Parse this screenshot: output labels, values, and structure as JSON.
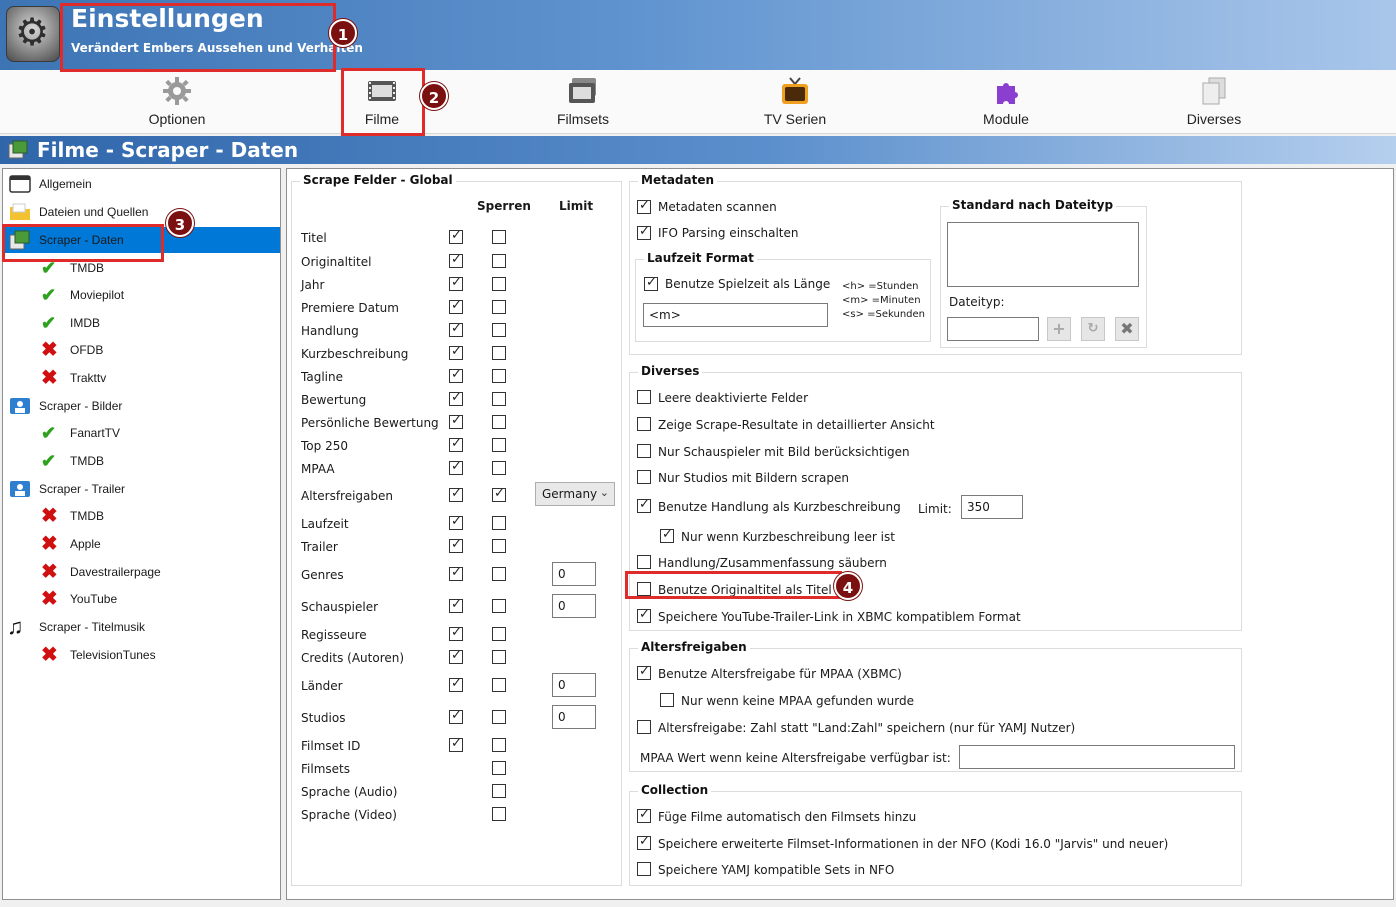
{
  "header": {
    "title": "Einstellungen",
    "subtitle": "Verändert Embers Aussehen und Verhalten"
  },
  "toolbar": {
    "items": [
      {
        "label": "Optionen",
        "icon": "gear-icon"
      },
      {
        "label": "Filme",
        "icon": "film-icon"
      },
      {
        "label": "Filmsets",
        "icon": "filmsets-icon"
      },
      {
        "label": "TV Serien",
        "icon": "tv-icon"
      },
      {
        "label": "Module",
        "icon": "puzzle-icon"
      },
      {
        "label": "Diverses",
        "icon": "documents-icon"
      }
    ]
  },
  "section": {
    "title": "Filme - Scraper - Daten"
  },
  "tree": {
    "items": [
      {
        "label": "Allgemein",
        "icon": "window-icon",
        "level": 0
      },
      {
        "label": "Dateien und Quellen",
        "icon": "folder-icon",
        "level": 0
      },
      {
        "label": "Scraper - Daten",
        "icon": "scraper-data-icon",
        "level": 0,
        "selected": true
      },
      {
        "label": "TMDB",
        "icon": "check-icon",
        "level": 1
      },
      {
        "label": "Moviepilot",
        "icon": "check-icon",
        "level": 1
      },
      {
        "label": "IMDB",
        "icon": "check-icon",
        "level": 1
      },
      {
        "label": "OFDB",
        "icon": "x-icon",
        "level": 1
      },
      {
        "label": "Trakttv",
        "icon": "x-icon",
        "level": 1
      },
      {
        "label": "Scraper - Bilder",
        "icon": "image-icon",
        "level": 0
      },
      {
        "label": "FanartTV",
        "icon": "check-icon",
        "level": 1
      },
      {
        "label": "TMDB",
        "icon": "check-icon",
        "level": 1
      },
      {
        "label": "Scraper - Trailer",
        "icon": "image-icon",
        "level": 0
      },
      {
        "label": "TMDB",
        "icon": "x-icon",
        "level": 1
      },
      {
        "label": "Apple",
        "icon": "x-icon",
        "level": 1
      },
      {
        "label": "Davestrailerpage",
        "icon": "x-icon",
        "level": 1
      },
      {
        "label": "YouTube",
        "icon": "x-icon",
        "level": 1
      },
      {
        "label": "Scraper - Titelmusik",
        "icon": "music-icon",
        "level": 0
      },
      {
        "label": "TelevisionTunes",
        "icon": "x-icon",
        "level": 1
      }
    ]
  },
  "scrape_fields": {
    "title": "Scrape Felder - Global",
    "col_lock": "Sperren",
    "col_limit": "Limit",
    "rows": [
      {
        "label": "Titel",
        "global": true,
        "lock": false
      },
      {
        "label": "Originaltitel",
        "global": true,
        "lock": false
      },
      {
        "label": "Jahr",
        "global": true,
        "lock": false
      },
      {
        "label": "Premiere Datum",
        "global": true,
        "lock": false
      },
      {
        "label": "Handlung",
        "global": true,
        "lock": false
      },
      {
        "label": "Kurzbeschreibung",
        "global": true,
        "lock": false
      },
      {
        "label": "Tagline",
        "global": true,
        "lock": false
      },
      {
        "label": "Bewertung",
        "global": true,
        "lock": false
      },
      {
        "label": "Persönliche Bewertung",
        "global": true,
        "lock": false
      },
      {
        "label": "Top 250",
        "global": true,
        "lock": false
      },
      {
        "label": "MPAA",
        "global": true,
        "lock": false
      },
      {
        "label": "Altersfreigaben",
        "global": true,
        "lock": true,
        "combo": "Germany"
      },
      {
        "label": "Laufzeit",
        "global": true,
        "lock": false
      },
      {
        "label": "Trailer",
        "global": true,
        "lock": false
      },
      {
        "label": "Genres",
        "global": true,
        "lock": false,
        "limit": "0"
      },
      {
        "label": "Schauspieler",
        "global": true,
        "lock": false,
        "limit": "0"
      },
      {
        "label": "Regisseure",
        "global": true,
        "lock": false
      },
      {
        "label": "Credits (Autoren)",
        "global": true,
        "lock": false
      },
      {
        "label": "Länder",
        "global": true,
        "lock": false,
        "limit": "0"
      },
      {
        "label": "Studios",
        "global": true,
        "lock": false,
        "limit": "0"
      },
      {
        "label": "Filmset ID",
        "global": true,
        "lock": false
      },
      {
        "label": "Filmsets",
        "global": null,
        "lock": false
      },
      {
        "label": "Sprache (Audio)",
        "global": null,
        "lock": false
      },
      {
        "label": "Sprache (Video)",
        "global": null,
        "lock": false
      }
    ]
  },
  "metadaten": {
    "title": "Metadaten",
    "scan": {
      "label": "Metadaten scannen",
      "checked": true
    },
    "ifo": {
      "label": "IFO Parsing einschalten",
      "checked": true
    },
    "laufzeit": {
      "title": "Laufzeit Format",
      "use_length": {
        "label": "Benutze Spielzeit als Länge",
        "checked": true
      },
      "format_value": "<m>",
      "legend_h": "<h> =Stunden",
      "legend_m": "<m> =Minuten",
      "legend_s": "<s> =Sekunden"
    },
    "standard": {
      "title": "Standard nach Dateityp",
      "dateityp_label": "Dateityp:",
      "dateityp_value": ""
    }
  },
  "diverses": {
    "title": "Diverses",
    "leere": {
      "label": "Leere deaktivierte Felder",
      "checked": false
    },
    "zeige": {
      "label": "Zeige Scrape-Resultate in detaillierter Ansicht",
      "checked": false
    },
    "schauspieler": {
      "label": "Nur Schauspieler mit Bild berücksichtigen",
      "checked": false
    },
    "studios": {
      "label": "Nur Studios mit Bildern scrapen",
      "checked": false
    },
    "handlung_kurz": {
      "label": "Benutze Handlung als Kurzbeschreibung",
      "checked": true
    },
    "limit_label": "Limit:",
    "limit_value": "350",
    "nur_wenn": {
      "label": "Nur wenn Kurzbeschreibung leer ist",
      "checked": true
    },
    "saeubern": {
      "label": "Handlung/Zusammenfassung säubern",
      "checked": false
    },
    "originaltitel": {
      "label": "Benutze Originaltitel als Titel",
      "checked": false
    },
    "youtube": {
      "label": "Speichere YouTube-Trailer-Link in XBMC kompatiblem Format",
      "checked": true
    }
  },
  "altersfreigaben": {
    "title": "Altersfreigaben",
    "mpaa": {
      "label": "Benutze Altersfreigabe für MPAA (XBMC)",
      "checked": true
    },
    "nur_wenn": {
      "label": "Nur wenn keine MPAA gefunden wurde",
      "checked": false
    },
    "zahl": {
      "label": "Altersfreigabe: Zahl statt \"Land:Zahl\" speichern (nur für YAMJ Nutzer)",
      "checked": false
    },
    "mpaa_wert_label": "MPAA Wert wenn keine Altersfreigabe verfügbar ist:",
    "mpaa_wert_value": ""
  },
  "collection": {
    "title": "Collection",
    "auto": {
      "label": "Füge Filme automatisch den Filmsets hinzu",
      "checked": true
    },
    "erweitert": {
      "label": "Speichere erweiterte Filmset-Informationen in der NFO (Kodi 16.0 \"Jarvis\" und neuer)",
      "checked": true
    },
    "yamj": {
      "label": "Speichere YAMJ kompatible Sets in NFO",
      "checked": false
    }
  },
  "callouts": [
    "1",
    "2",
    "3",
    "4"
  ],
  "colors": {
    "selected": "#0078d7",
    "callout_red": "#e02b2b",
    "badge": "#7a1010"
  }
}
